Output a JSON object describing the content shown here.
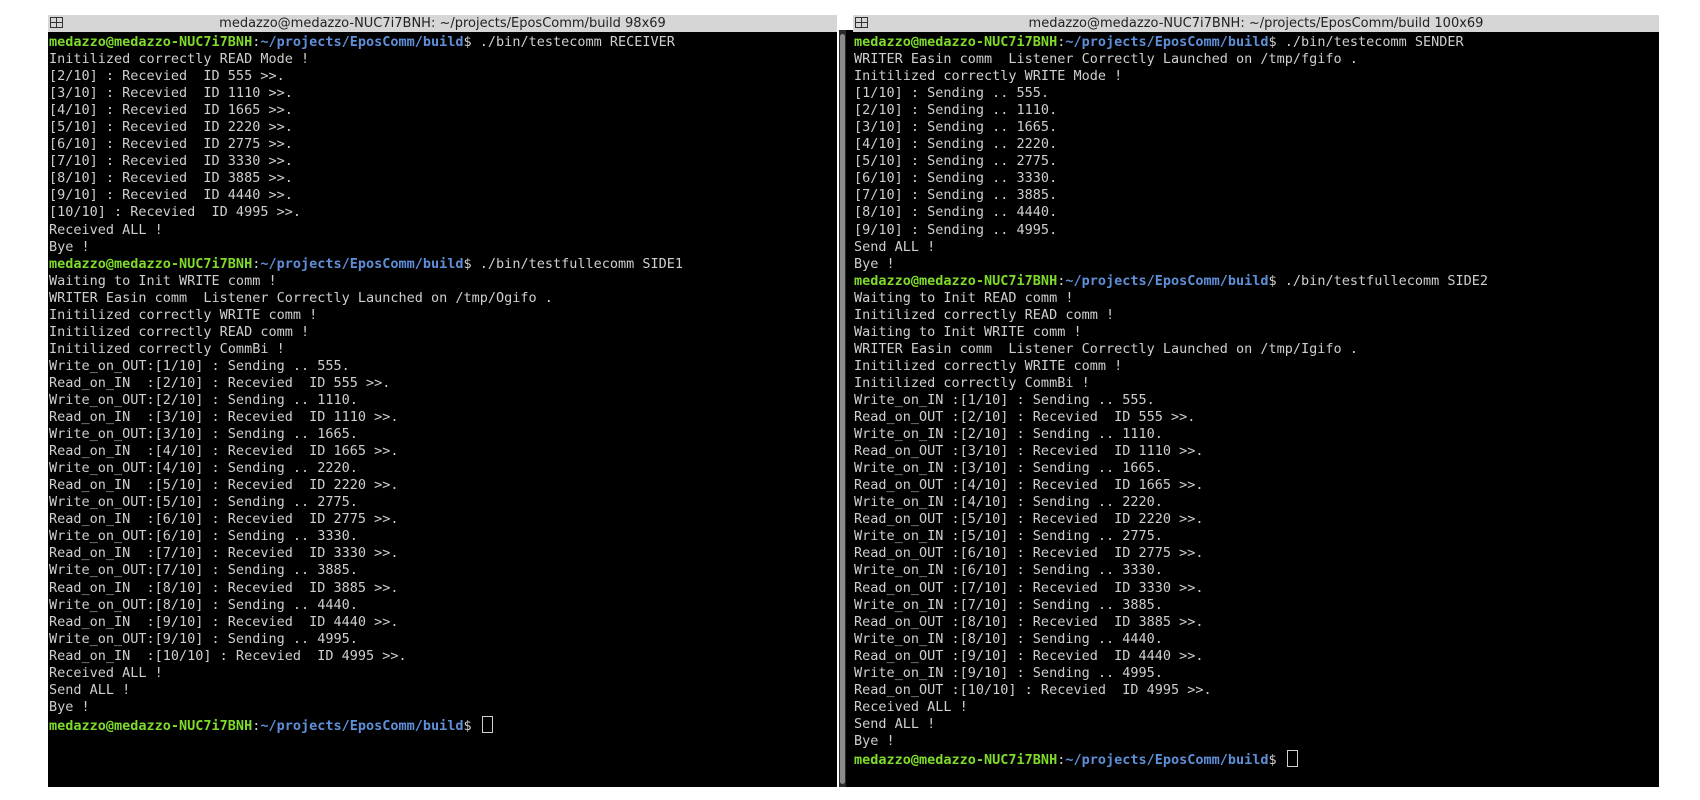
{
  "left": {
    "title": "medazzo@medazzo-NUC7i7BNH: ~/projects/EposComm/build 98x69",
    "lines": [
      {
        "user": "medazzo@medazzo-NUC7i7BNH",
        "sep": ":",
        "path": "~/projects/EposComm/build",
        "cmd": "$ ./bin/testecomm RECEIVER"
      },
      {
        "text": "Initilized correctly READ Mode !"
      },
      {
        "text": "[2/10] : Recevied  ID 555 >>."
      },
      {
        "text": "[3/10] : Recevied  ID 1110 >>."
      },
      {
        "text": "[4/10] : Recevied  ID 1665 >>."
      },
      {
        "text": "[5/10] : Recevied  ID 2220 >>."
      },
      {
        "text": "[6/10] : Recevied  ID 2775 >>."
      },
      {
        "text": "[7/10] : Recevied  ID 3330 >>."
      },
      {
        "text": "[8/10] : Recevied  ID 3885 >>."
      },
      {
        "text": "[9/10] : Recevied  ID 4440 >>."
      },
      {
        "text": "[10/10] : Recevied  ID 4995 >>."
      },
      {
        "text": "Received ALL !"
      },
      {
        "text": "Bye !"
      },
      {
        "user": "medazzo@medazzo-NUC7i7BNH",
        "sep": ":",
        "path": "~/projects/EposComm/build",
        "cmd": "$ ./bin/testfullecomm SIDE1"
      },
      {
        "text": "Waiting to Init WRITE comm !"
      },
      {
        "text": "WRITER Easin comm  Listener Correctly Launched on /tmp/Ogifo ."
      },
      {
        "text": "Initilized correctly WRITE comm !"
      },
      {
        "text": "Initilized correctly READ comm !"
      },
      {
        "text": "Initilized correctly CommBi !"
      },
      {
        "text": "Write_on_OUT:[1/10] : Sending .. 555."
      },
      {
        "text": "Read_on_IN  :[2/10] : Recevied  ID 555 >>."
      },
      {
        "text": "Write_on_OUT:[2/10] : Sending .. 1110."
      },
      {
        "text": "Read_on_IN  :[3/10] : Recevied  ID 1110 >>."
      },
      {
        "text": "Write_on_OUT:[3/10] : Sending .. 1665."
      },
      {
        "text": "Read_on_IN  :[4/10] : Recevied  ID 1665 >>."
      },
      {
        "text": "Write_on_OUT:[4/10] : Sending .. 2220."
      },
      {
        "text": "Read_on_IN  :[5/10] : Recevied  ID 2220 >>."
      },
      {
        "text": "Write_on_OUT:[5/10] : Sending .. 2775."
      },
      {
        "text": "Read_on_IN  :[6/10] : Recevied  ID 2775 >>."
      },
      {
        "text": "Write_on_OUT:[6/10] : Sending .. 3330."
      },
      {
        "text": "Read_on_IN  :[7/10] : Recevied  ID 3330 >>."
      },
      {
        "text": "Write_on_OUT:[7/10] : Sending .. 3885."
      },
      {
        "text": "Read_on_IN  :[8/10] : Recevied  ID 3885 >>."
      },
      {
        "text": "Write_on_OUT:[8/10] : Sending .. 4440."
      },
      {
        "text": "Read_on_IN  :[9/10] : Recevied  ID 4440 >>."
      },
      {
        "text": "Write_on_OUT:[9/10] : Sending .. 4995."
      },
      {
        "text": "Read_on_IN  :[10/10] : Recevied  ID 4995 >>."
      },
      {
        "text": "Received ALL !"
      },
      {
        "text": "Send ALL !"
      },
      {
        "text": "Bye !"
      },
      {
        "user": "medazzo@medazzo-NUC7i7BNH",
        "sep": ":",
        "path": "~/projects/EposComm/build",
        "cmd": "$ ",
        "cursor": true
      }
    ]
  },
  "right": {
    "title": "medazzo@medazzo-NUC7i7BNH: ~/projects/EposComm/build 100x69",
    "lines": [
      {
        "user": "medazzo@medazzo-NUC7i7BNH",
        "sep": ":",
        "path": "~/projects/EposComm/build",
        "cmd": "$ ./bin/testecomm SENDER"
      },
      {
        "text": "WRITER Easin comm  Listener Correctly Launched on /tmp/fgifo ."
      },
      {
        "text": "Initilized correctly WRITE Mode !"
      },
      {
        "text": "[1/10] : Sending .. 555."
      },
      {
        "text": "[2/10] : Sending .. 1110."
      },
      {
        "text": "[3/10] : Sending .. 1665."
      },
      {
        "text": "[4/10] : Sending .. 2220."
      },
      {
        "text": "[5/10] : Sending .. 2775."
      },
      {
        "text": "[6/10] : Sending .. 3330."
      },
      {
        "text": "[7/10] : Sending .. 3885."
      },
      {
        "text": "[8/10] : Sending .. 4440."
      },
      {
        "text": "[9/10] : Sending .. 4995."
      },
      {
        "text": "Send ALL !"
      },
      {
        "text": "Bye !"
      },
      {
        "user": "medazzo@medazzo-NUC7i7BNH",
        "sep": ":",
        "path": "~/projects/EposComm/build",
        "cmd": "$ ./bin/testfullecomm SIDE2"
      },
      {
        "text": "Waiting to Init READ comm !"
      },
      {
        "text": "Initilized correctly READ comm !"
      },
      {
        "text": "Waiting to Init WRITE comm !"
      },
      {
        "text": "WRITER Easin comm  Listener Correctly Launched on /tmp/Igifo ."
      },
      {
        "text": "Initilized correctly WRITE comm !"
      },
      {
        "text": "Initilized correctly CommBi !"
      },
      {
        "text": "Write_on_IN :[1/10] : Sending .. 555."
      },
      {
        "text": "Read_on_OUT :[2/10] : Recevied  ID 555 >>."
      },
      {
        "text": "Write_on_IN :[2/10] : Sending .. 1110."
      },
      {
        "text": "Read_on_OUT :[3/10] : Recevied  ID 1110 >>."
      },
      {
        "text": "Write_on_IN :[3/10] : Sending .. 1665."
      },
      {
        "text": "Read_on_OUT :[4/10] : Recevied  ID 1665 >>."
      },
      {
        "text": "Write_on_IN :[4/10] : Sending .. 2220."
      },
      {
        "text": "Read_on_OUT :[5/10] : Recevied  ID 2220 >>."
      },
      {
        "text": "Write_on_IN :[5/10] : Sending .. 2775."
      },
      {
        "text": "Read_on_OUT :[6/10] : Recevied  ID 2775 >>."
      },
      {
        "text": "Write_on_IN :[6/10] : Sending .. 3330."
      },
      {
        "text": "Read_on_OUT :[7/10] : Recevied  ID 3330 >>."
      },
      {
        "text": "Write_on_IN :[7/10] : Sending .. 3885."
      },
      {
        "text": "Read_on_OUT :[8/10] : Recevied  ID 3885 >>."
      },
      {
        "text": "Write_on_IN :[8/10] : Sending .. 4440."
      },
      {
        "text": "Read_on_OUT :[9/10] : Recevied  ID 4440 >>."
      },
      {
        "text": "Write_on_IN :[9/10] : Sending .. 4995."
      },
      {
        "text": "Read_on_OUT :[10/10] : Recevied  ID 4995 >>."
      },
      {
        "text": "Received ALL !"
      },
      {
        "text": "Send ALL !"
      },
      {
        "text": "Bye !"
      },
      {
        "user": "medazzo@medazzo-NUC7i7BNH",
        "sep": ":",
        "path": "~/projects/EposComm/build",
        "cmd": "$ ",
        "cursor": true
      }
    ]
  },
  "colors": {
    "background": "#000000",
    "text": "#cfcfcf",
    "prompt_user": "#7fdc2a",
    "prompt_path": "#5f8fd8",
    "titlebar": "#d6d6d6"
  },
  "icons": {
    "tile": "tile-layout-icon"
  }
}
